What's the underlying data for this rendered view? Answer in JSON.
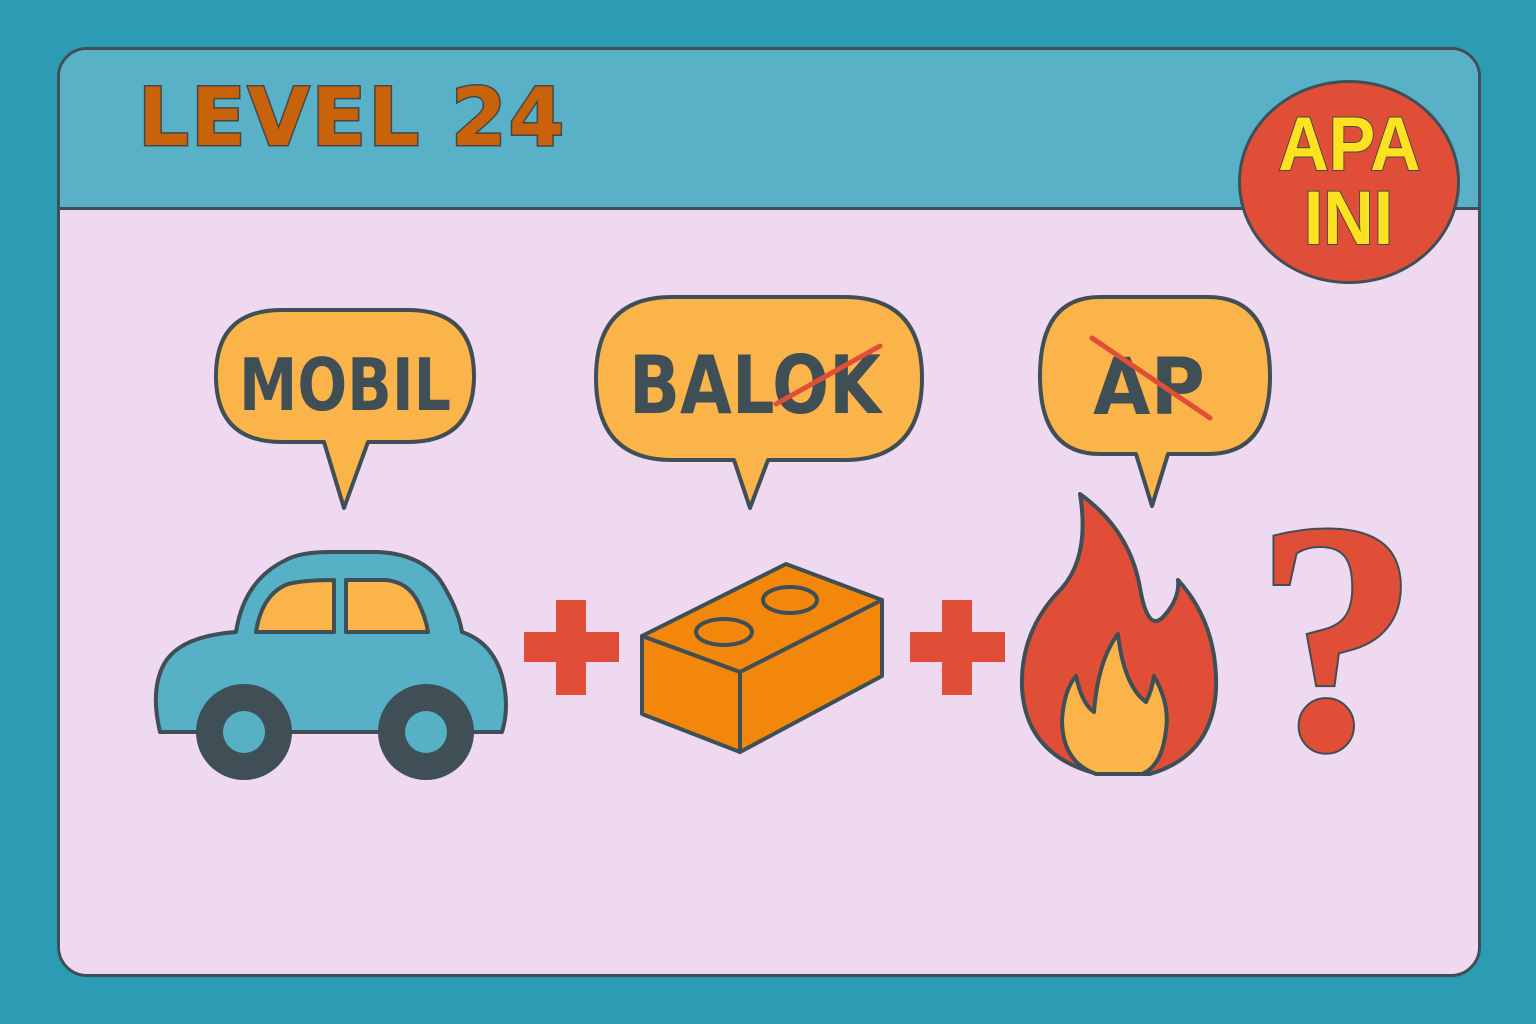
{
  "level": {
    "title": "LEVEL 24"
  },
  "badge": {
    "line1": "APA",
    "line2": "INI"
  },
  "clues": [
    {
      "word": "MOBIL",
      "icon": "car-icon",
      "struck_letters": ""
    },
    {
      "word": "BALOK",
      "icon": "brick-icon",
      "struck_letters": "OK"
    },
    {
      "word": "AP",
      "icon": "fire-icon",
      "struck_letters": "AP"
    }
  ],
  "operators": {
    "plus_1": "+",
    "plus_2": "+"
  },
  "answer": {
    "symbol": "?"
  },
  "colors": {
    "background": "#2b9cb3",
    "header": "#58b1c6",
    "card": "#eed9f1",
    "title": "#c8620b",
    "badge": "#e04e37",
    "badge_text": "#ffe21f",
    "bubble": "#fbb44a",
    "outline": "#3f4f55",
    "strike": "#e04e37",
    "plus": "#e04e37",
    "car": "#56b0c6",
    "brick": "#f3870c",
    "fire_outer": "#e04e37",
    "fire_inner": "#fbb44a"
  }
}
